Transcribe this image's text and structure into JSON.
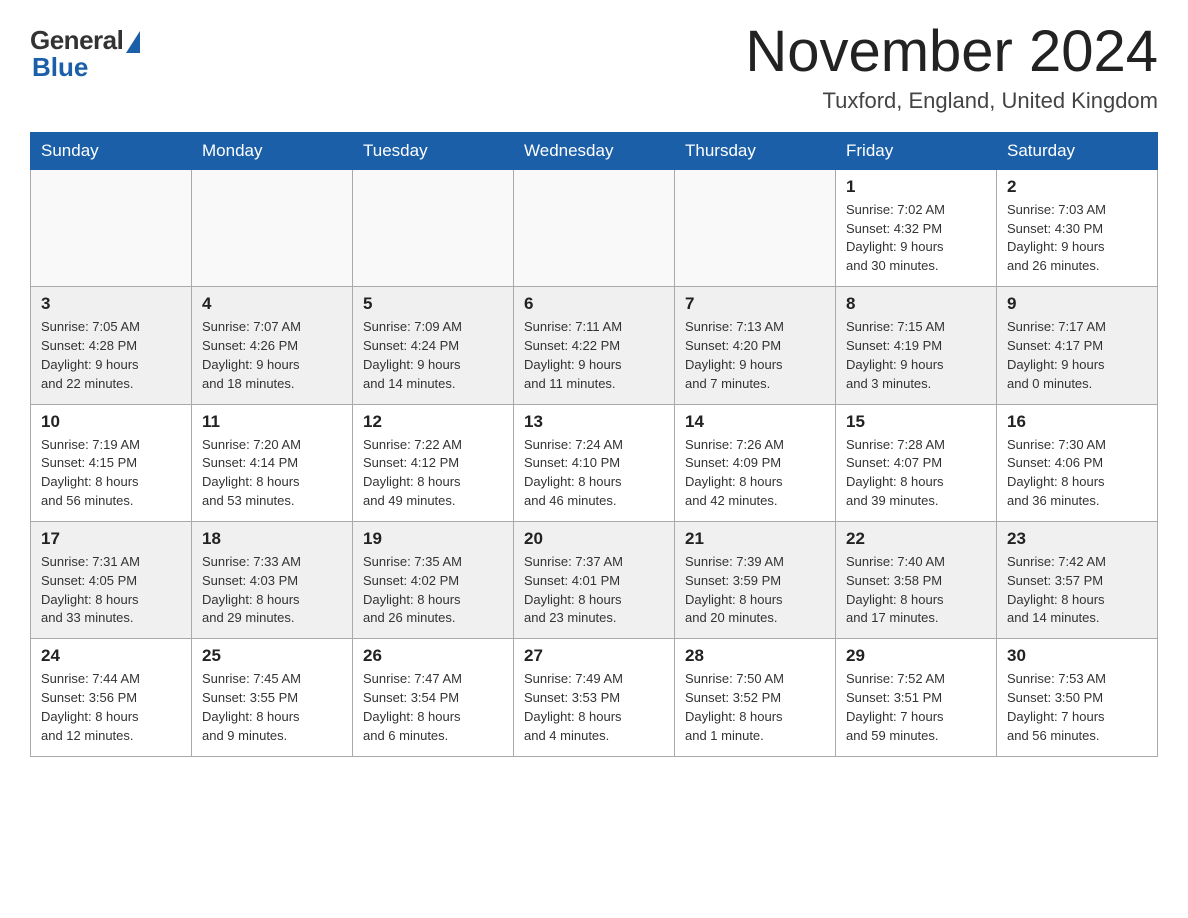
{
  "header": {
    "logo_general": "General",
    "logo_blue": "Blue",
    "month_title": "November 2024",
    "location": "Tuxford, England, United Kingdom"
  },
  "days_of_week": [
    "Sunday",
    "Monday",
    "Tuesday",
    "Wednesday",
    "Thursday",
    "Friday",
    "Saturday"
  ],
  "weeks": [
    {
      "days": [
        {
          "number": "",
          "info": ""
        },
        {
          "number": "",
          "info": ""
        },
        {
          "number": "",
          "info": ""
        },
        {
          "number": "",
          "info": ""
        },
        {
          "number": "",
          "info": ""
        },
        {
          "number": "1",
          "info": "Sunrise: 7:02 AM\nSunset: 4:32 PM\nDaylight: 9 hours\nand 30 minutes."
        },
        {
          "number": "2",
          "info": "Sunrise: 7:03 AM\nSunset: 4:30 PM\nDaylight: 9 hours\nand 26 minutes."
        }
      ]
    },
    {
      "days": [
        {
          "number": "3",
          "info": "Sunrise: 7:05 AM\nSunset: 4:28 PM\nDaylight: 9 hours\nand 22 minutes."
        },
        {
          "number": "4",
          "info": "Sunrise: 7:07 AM\nSunset: 4:26 PM\nDaylight: 9 hours\nand 18 minutes."
        },
        {
          "number": "5",
          "info": "Sunrise: 7:09 AM\nSunset: 4:24 PM\nDaylight: 9 hours\nand 14 minutes."
        },
        {
          "number": "6",
          "info": "Sunrise: 7:11 AM\nSunset: 4:22 PM\nDaylight: 9 hours\nand 11 minutes."
        },
        {
          "number": "7",
          "info": "Sunrise: 7:13 AM\nSunset: 4:20 PM\nDaylight: 9 hours\nand 7 minutes."
        },
        {
          "number": "8",
          "info": "Sunrise: 7:15 AM\nSunset: 4:19 PM\nDaylight: 9 hours\nand 3 minutes."
        },
        {
          "number": "9",
          "info": "Sunrise: 7:17 AM\nSunset: 4:17 PM\nDaylight: 9 hours\nand 0 minutes."
        }
      ]
    },
    {
      "days": [
        {
          "number": "10",
          "info": "Sunrise: 7:19 AM\nSunset: 4:15 PM\nDaylight: 8 hours\nand 56 minutes."
        },
        {
          "number": "11",
          "info": "Sunrise: 7:20 AM\nSunset: 4:14 PM\nDaylight: 8 hours\nand 53 minutes."
        },
        {
          "number": "12",
          "info": "Sunrise: 7:22 AM\nSunset: 4:12 PM\nDaylight: 8 hours\nand 49 minutes."
        },
        {
          "number": "13",
          "info": "Sunrise: 7:24 AM\nSunset: 4:10 PM\nDaylight: 8 hours\nand 46 minutes."
        },
        {
          "number": "14",
          "info": "Sunrise: 7:26 AM\nSunset: 4:09 PM\nDaylight: 8 hours\nand 42 minutes."
        },
        {
          "number": "15",
          "info": "Sunrise: 7:28 AM\nSunset: 4:07 PM\nDaylight: 8 hours\nand 39 minutes."
        },
        {
          "number": "16",
          "info": "Sunrise: 7:30 AM\nSunset: 4:06 PM\nDaylight: 8 hours\nand 36 minutes."
        }
      ]
    },
    {
      "days": [
        {
          "number": "17",
          "info": "Sunrise: 7:31 AM\nSunset: 4:05 PM\nDaylight: 8 hours\nand 33 minutes."
        },
        {
          "number": "18",
          "info": "Sunrise: 7:33 AM\nSunset: 4:03 PM\nDaylight: 8 hours\nand 29 minutes."
        },
        {
          "number": "19",
          "info": "Sunrise: 7:35 AM\nSunset: 4:02 PM\nDaylight: 8 hours\nand 26 minutes."
        },
        {
          "number": "20",
          "info": "Sunrise: 7:37 AM\nSunset: 4:01 PM\nDaylight: 8 hours\nand 23 minutes."
        },
        {
          "number": "21",
          "info": "Sunrise: 7:39 AM\nSunset: 3:59 PM\nDaylight: 8 hours\nand 20 minutes."
        },
        {
          "number": "22",
          "info": "Sunrise: 7:40 AM\nSunset: 3:58 PM\nDaylight: 8 hours\nand 17 minutes."
        },
        {
          "number": "23",
          "info": "Sunrise: 7:42 AM\nSunset: 3:57 PM\nDaylight: 8 hours\nand 14 minutes."
        }
      ]
    },
    {
      "days": [
        {
          "number": "24",
          "info": "Sunrise: 7:44 AM\nSunset: 3:56 PM\nDaylight: 8 hours\nand 12 minutes."
        },
        {
          "number": "25",
          "info": "Sunrise: 7:45 AM\nSunset: 3:55 PM\nDaylight: 8 hours\nand 9 minutes."
        },
        {
          "number": "26",
          "info": "Sunrise: 7:47 AM\nSunset: 3:54 PM\nDaylight: 8 hours\nand 6 minutes."
        },
        {
          "number": "27",
          "info": "Sunrise: 7:49 AM\nSunset: 3:53 PM\nDaylight: 8 hours\nand 4 minutes."
        },
        {
          "number": "28",
          "info": "Sunrise: 7:50 AM\nSunset: 3:52 PM\nDaylight: 8 hours\nand 1 minute."
        },
        {
          "number": "29",
          "info": "Sunrise: 7:52 AM\nSunset: 3:51 PM\nDaylight: 7 hours\nand 59 minutes."
        },
        {
          "number": "30",
          "info": "Sunrise: 7:53 AM\nSunset: 3:50 PM\nDaylight: 7 hours\nand 56 minutes."
        }
      ]
    }
  ]
}
